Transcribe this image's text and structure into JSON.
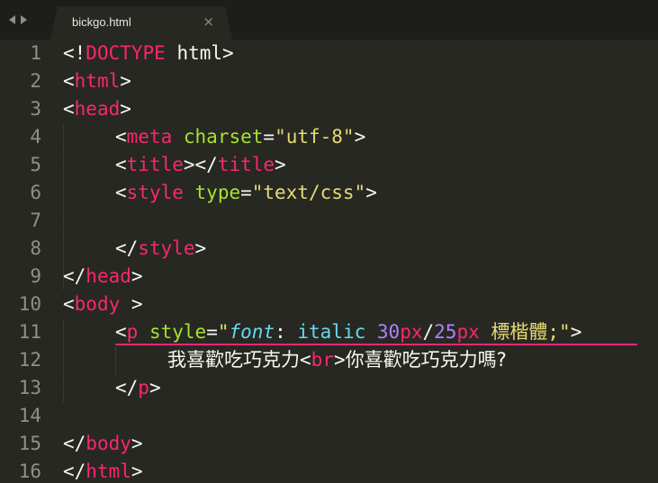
{
  "tab": {
    "title": "bickgo.html",
    "close_glyph": "×"
  },
  "colors": {
    "background": "#272822",
    "tag": "#f92672",
    "attribute": "#a6e22e",
    "string": "#e6db74",
    "number": "#ae81ff",
    "keyword": "#66d9ef"
  },
  "lines": [
    {
      "no": "1"
    },
    {
      "no": "2"
    },
    {
      "no": "3"
    },
    {
      "no": "4"
    },
    {
      "no": "5"
    },
    {
      "no": "6"
    },
    {
      "no": "7"
    },
    {
      "no": "8"
    },
    {
      "no": "9"
    },
    {
      "no": "10"
    },
    {
      "no": "11"
    },
    {
      "no": "12"
    },
    {
      "no": "13"
    },
    {
      "no": "14"
    },
    {
      "no": "15"
    },
    {
      "no": "16"
    }
  ],
  "code": {
    "l1": {
      "open": "<!",
      "doctype": "DOCTYPE",
      "rest": " html>"
    },
    "l2": {
      "open": "<",
      "tag": "html",
      "close": ">"
    },
    "l3": {
      "open": "<",
      "tag": "head",
      "close": ">"
    },
    "l4": {
      "open": "<",
      "tag": "meta",
      "attr": "charset",
      "eq": "=",
      "value": "\"utf-8\"",
      "close": ">"
    },
    "l5": {
      "open": "<",
      "tag": "title",
      "mid": "></",
      "tag2": "title",
      "close": ">"
    },
    "l6": {
      "open": "<",
      "tag": "style",
      "attr": "type",
      "eq": "=",
      "value": "\"text/css\"",
      "close": ">"
    },
    "l8": {
      "open": "</",
      "tag": "style",
      "close": ">"
    },
    "l9": {
      "open": "</",
      "tag": "head",
      "close": ">"
    },
    "l10": {
      "open": "<",
      "tag": "body",
      "close": " >"
    },
    "l11": {
      "open": "<",
      "tag": "p",
      "attr": "style",
      "eq": "=",
      "quote_open": "\"",
      "prop": "font",
      "colon": ": ",
      "italic": "italic",
      "num1": "30",
      "unit1": "px",
      "slash": "/",
      "num2": "25",
      "unit2": "px",
      "fontname": "標楷體",
      "semi": ";",
      "quote_close": "\"",
      "close": ">"
    },
    "l12": {
      "text1": "我喜歡吃巧克力",
      "br_open": "<",
      "br": "br",
      "br_close": ">",
      "text2": "你喜歡吃巧克力嗎?"
    },
    "l13": {
      "open": "</",
      "tag": "p",
      "close": ">"
    },
    "l15": {
      "open": "</",
      "tag": "body",
      "close": ">"
    },
    "l16": {
      "open": "</",
      "tag": "html",
      "close": ">"
    }
  }
}
